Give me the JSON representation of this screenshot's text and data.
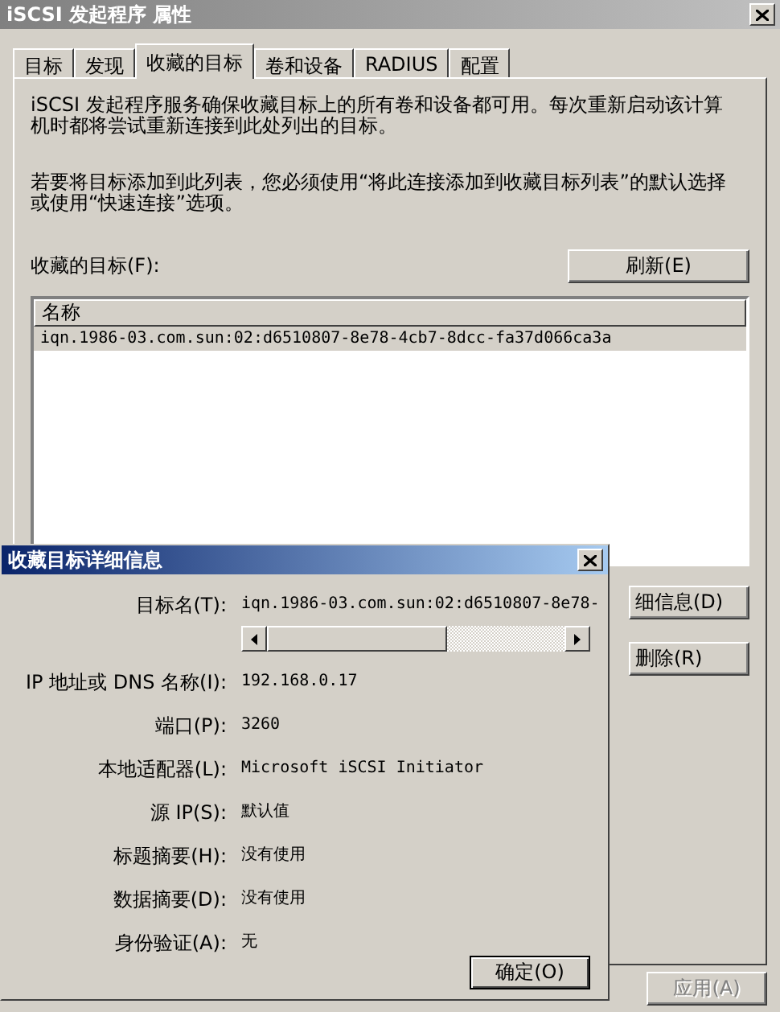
{
  "window": {
    "title": "iSCSI 发起程序 属性"
  },
  "tabs": [
    {
      "label": "目标",
      "selected": false
    },
    {
      "label": "发现",
      "selected": false
    },
    {
      "label": "收藏的目标",
      "selected": true
    },
    {
      "label": "卷和设备",
      "selected": false
    },
    {
      "label": "RADIUS",
      "selected": false
    },
    {
      "label": "配置",
      "selected": false
    }
  ],
  "description": [
    "iSCSI 发起程序服务确保收藏目标上的所有卷和设备都可用。每次重新启动该计算机时都将尝试重新连接到此处列出的目标。",
    "若要将目标添加到此列表，您必须使用“将此连接添加到收藏目标列表”的默认选择或使用“快速连接”选项。"
  ],
  "list_label": "收藏的目标(F):",
  "refresh_button": "刷新(E)",
  "table": {
    "columns": [
      "名称"
    ],
    "rows": [
      {
        "name": "iqn.1986-03.com.sun:02:d6510807-8e78-4cb7-8dcc-fa37d066ca3a",
        "selected": true
      }
    ]
  },
  "side_buttons": [
    "细信息(D)",
    "删除(R)"
  ],
  "apply_button": {
    "label": "应用(A)",
    "disabled": true
  },
  "dialog": {
    "title": "收藏目标详细信息",
    "fields": [
      {
        "label": "目标名(T):",
        "value": "iqn.1986-03.com.sun:02:d6510807-8e78-",
        "kind": "scroll"
      },
      {
        "label": "IP 地址或 DNS 名称(I):",
        "value": "192.168.0.17",
        "kind": "text"
      },
      {
        "label": "端口(P):",
        "value": "3260",
        "kind": "text"
      },
      {
        "label": "本地适配器(L):",
        "value": "Microsoft iSCSI Initiator",
        "kind": "text"
      },
      {
        "label": "源 IP(S):",
        "value": "默认值",
        "kind": "text"
      },
      {
        "label": "标题摘要(H):",
        "value": "没有使用",
        "kind": "text"
      },
      {
        "label": "数据摘要(D):",
        "value": "没有使用",
        "kind": "text"
      },
      {
        "label": "身份验证(A):",
        "value": "无",
        "kind": "text"
      }
    ],
    "ok_button": "确定(O)"
  }
}
